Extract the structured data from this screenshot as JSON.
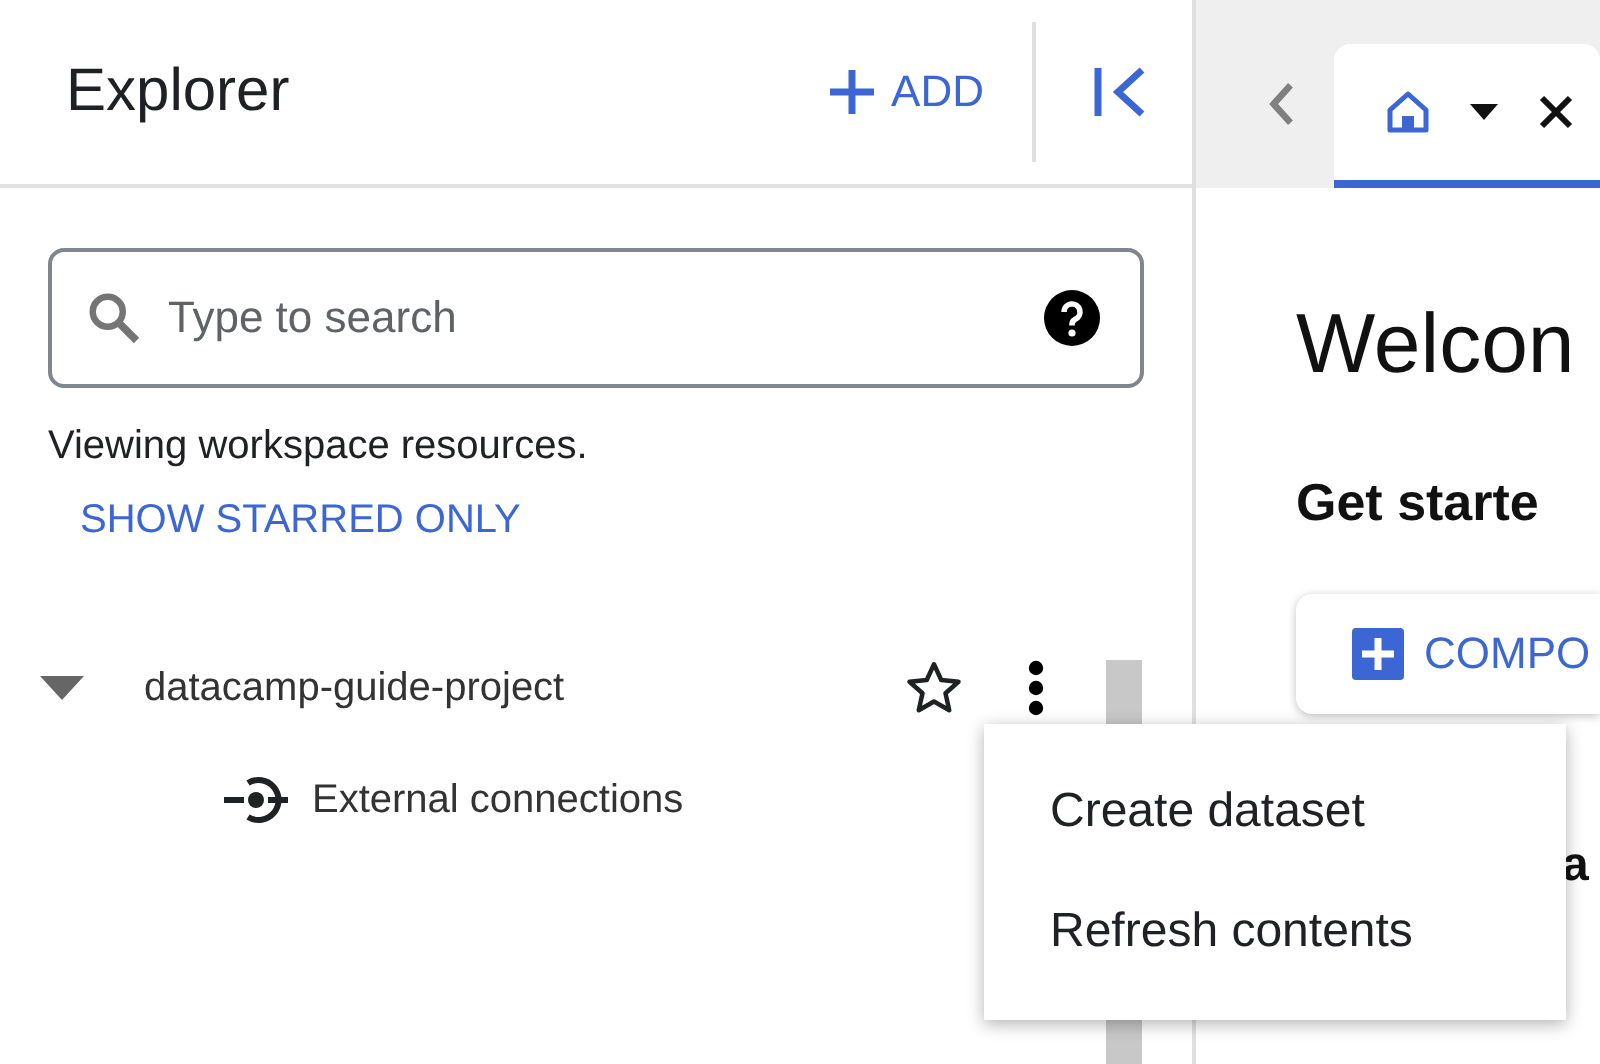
{
  "explorer": {
    "title": "Explorer",
    "add_button": "ADD",
    "search": {
      "placeholder": "Type to search"
    },
    "scope_note": "Viewing workspace resources.",
    "starred_link": "SHOW STARRED ONLY",
    "tree": [
      {
        "label": "datacamp-guide-project",
        "expanded": true,
        "starred": false,
        "children": [
          {
            "label": "External connections"
          }
        ]
      }
    ]
  },
  "context_menu": {
    "items": [
      "Create dataset",
      "Refresh contents"
    ]
  },
  "main": {
    "tabs": [
      {
        "selected": true
      }
    ],
    "heading": "Welcon",
    "subheading": "Get starte",
    "compose_button": "COMPO",
    "section_fragment": "a"
  }
}
